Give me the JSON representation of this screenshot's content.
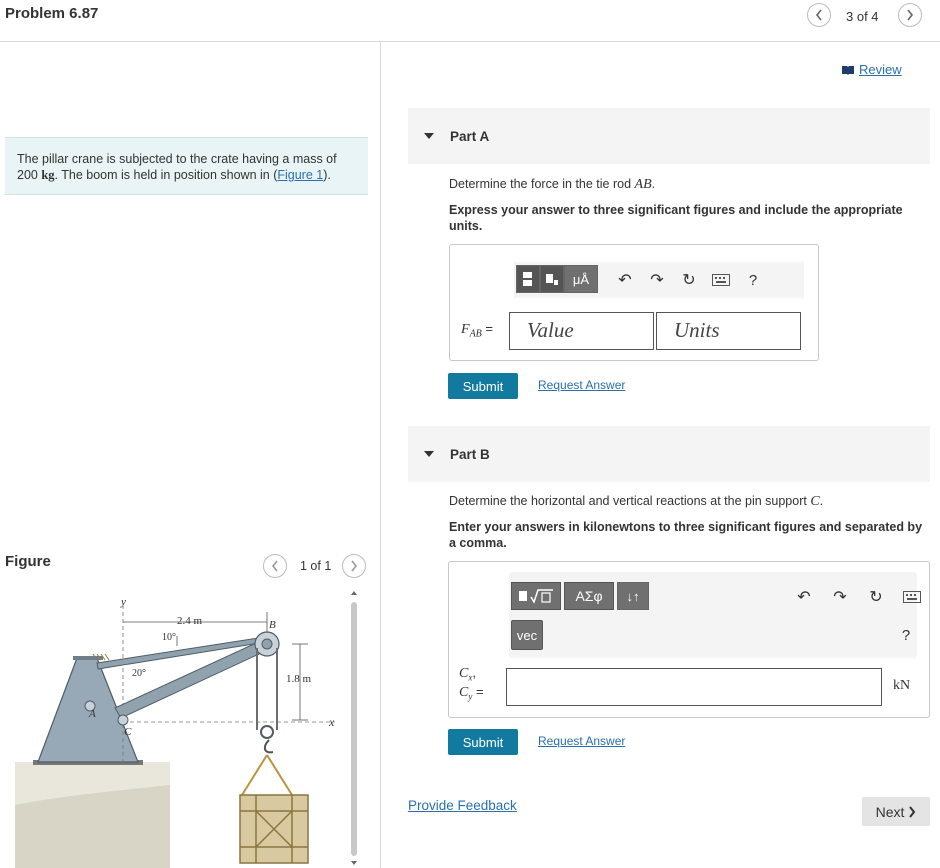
{
  "header": {
    "title": "Problem 6.87",
    "page_counter": "3 of 4",
    "prev_icon": "chevron-left-icon",
    "next_icon": "chevron-right-icon"
  },
  "statement": {
    "text_1": "The pillar crane is subjected to the crate having a mass of 200 ",
    "unit": "kg",
    "text_2": ". The boom is held in position shown in (",
    "figure_link": "Figure 1",
    "text_3": ")."
  },
  "figure": {
    "label": "Figure",
    "counter": "1 of 1",
    "labels": {
      "y": "y",
      "width": "2.4 m",
      "angle_top": "10°",
      "b": "B",
      "angle_left": "20°",
      "height": "1.8 m",
      "a": "A",
      "c": "C",
      "x": "x"
    }
  },
  "review": {
    "label": "Review"
  },
  "part_a": {
    "label": "Part A",
    "question_1": "Determine the force in the tie rod ",
    "question_var": "AB",
    "question_2": ".",
    "instruction": "Express your answer to three significant figures and include the appropriate units.",
    "toolbar_units": "μÅ",
    "help": "?",
    "var_main": "F",
    "var_sub": "AB",
    "equals": "=",
    "value_placeholder": "Value",
    "units_placeholder": "Units",
    "submit": "Submit",
    "request": "Request Answer"
  },
  "part_b": {
    "label": "Part B",
    "question_1": "Determine the horizontal and vertical reactions at the pin support ",
    "question_var": "C",
    "question_2": ".",
    "instruction": "Enter your answers in kilonewtons to three significant figures and separated by a comma.",
    "toolbar_greek": "ΑΣφ",
    "toolbar_sort": "↓↑",
    "vec": "vec",
    "help": "?",
    "var_cx": "C",
    "var_cx_sub": "x",
    "comma": ",",
    "var_cy": "C",
    "var_cy_sub": "y",
    "equals": "=",
    "unit": "kN",
    "submit": "Submit",
    "request": "Request Answer"
  },
  "footer": {
    "feedback": "Provide Feedback",
    "next": "Next"
  }
}
